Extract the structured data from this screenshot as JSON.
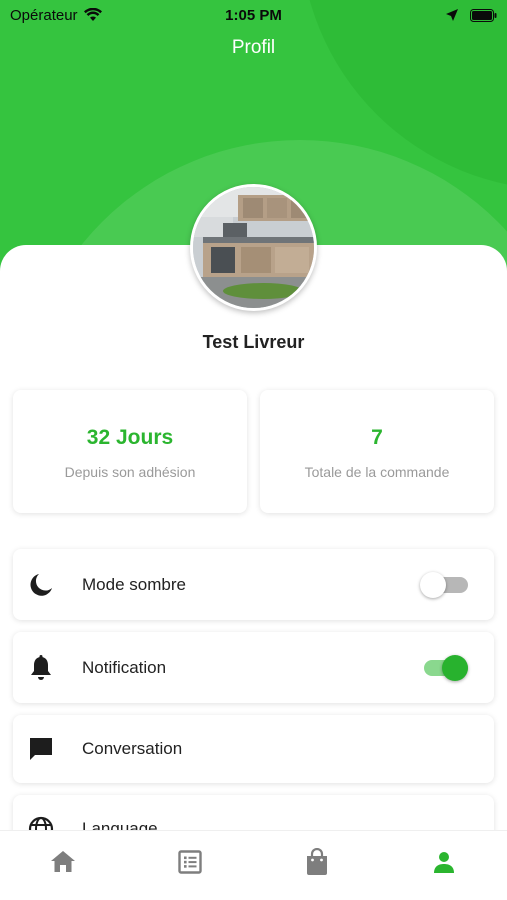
{
  "status": {
    "carrier": "Opérateur",
    "time": "1:05 PM"
  },
  "header": {
    "title": "Profil"
  },
  "profile": {
    "name": "Test Livreur"
  },
  "stats": [
    {
      "value": "32 Jours",
      "label": "Depuis son adhésion"
    },
    {
      "value": "7",
      "label": "Totale de la commande"
    }
  ],
  "settings": [
    {
      "label": "Mode sombre",
      "icon": "moon-icon",
      "toggle": false
    },
    {
      "label": "Notification",
      "icon": "bell-icon",
      "toggle": true
    },
    {
      "label": "Conversation",
      "icon": "chat-icon"
    },
    {
      "label": "Language",
      "icon": "globe-icon"
    }
  ],
  "nav": [
    "home-icon",
    "list-icon",
    "bag-icon",
    "profile-icon"
  ],
  "colors": {
    "accent": "#2bb52f",
    "header": "#35c43f"
  }
}
